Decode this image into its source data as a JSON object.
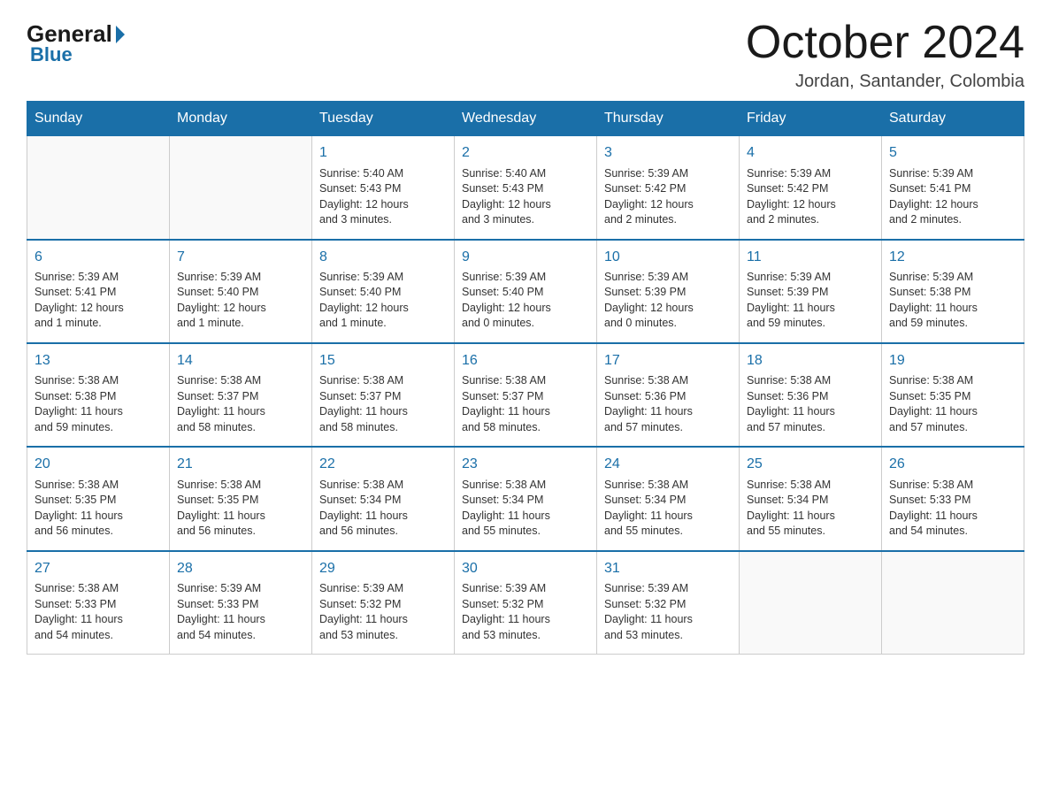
{
  "logo": {
    "general": "General",
    "blue": "Blue"
  },
  "title": "October 2024",
  "location": "Jordan, Santander, Colombia",
  "weekdays": [
    "Sunday",
    "Monday",
    "Tuesday",
    "Wednesday",
    "Thursday",
    "Friday",
    "Saturday"
  ],
  "weeks": [
    [
      {
        "day": "",
        "info": ""
      },
      {
        "day": "",
        "info": ""
      },
      {
        "day": "1",
        "info": "Sunrise: 5:40 AM\nSunset: 5:43 PM\nDaylight: 12 hours\nand 3 minutes."
      },
      {
        "day": "2",
        "info": "Sunrise: 5:40 AM\nSunset: 5:43 PM\nDaylight: 12 hours\nand 3 minutes."
      },
      {
        "day": "3",
        "info": "Sunrise: 5:39 AM\nSunset: 5:42 PM\nDaylight: 12 hours\nand 2 minutes."
      },
      {
        "day": "4",
        "info": "Sunrise: 5:39 AM\nSunset: 5:42 PM\nDaylight: 12 hours\nand 2 minutes."
      },
      {
        "day": "5",
        "info": "Sunrise: 5:39 AM\nSunset: 5:41 PM\nDaylight: 12 hours\nand 2 minutes."
      }
    ],
    [
      {
        "day": "6",
        "info": "Sunrise: 5:39 AM\nSunset: 5:41 PM\nDaylight: 12 hours\nand 1 minute."
      },
      {
        "day": "7",
        "info": "Sunrise: 5:39 AM\nSunset: 5:40 PM\nDaylight: 12 hours\nand 1 minute."
      },
      {
        "day": "8",
        "info": "Sunrise: 5:39 AM\nSunset: 5:40 PM\nDaylight: 12 hours\nand 1 minute."
      },
      {
        "day": "9",
        "info": "Sunrise: 5:39 AM\nSunset: 5:40 PM\nDaylight: 12 hours\nand 0 minutes."
      },
      {
        "day": "10",
        "info": "Sunrise: 5:39 AM\nSunset: 5:39 PM\nDaylight: 12 hours\nand 0 minutes."
      },
      {
        "day": "11",
        "info": "Sunrise: 5:39 AM\nSunset: 5:39 PM\nDaylight: 11 hours\nand 59 minutes."
      },
      {
        "day": "12",
        "info": "Sunrise: 5:39 AM\nSunset: 5:38 PM\nDaylight: 11 hours\nand 59 minutes."
      }
    ],
    [
      {
        "day": "13",
        "info": "Sunrise: 5:38 AM\nSunset: 5:38 PM\nDaylight: 11 hours\nand 59 minutes."
      },
      {
        "day": "14",
        "info": "Sunrise: 5:38 AM\nSunset: 5:37 PM\nDaylight: 11 hours\nand 58 minutes."
      },
      {
        "day": "15",
        "info": "Sunrise: 5:38 AM\nSunset: 5:37 PM\nDaylight: 11 hours\nand 58 minutes."
      },
      {
        "day": "16",
        "info": "Sunrise: 5:38 AM\nSunset: 5:37 PM\nDaylight: 11 hours\nand 58 minutes."
      },
      {
        "day": "17",
        "info": "Sunrise: 5:38 AM\nSunset: 5:36 PM\nDaylight: 11 hours\nand 57 minutes."
      },
      {
        "day": "18",
        "info": "Sunrise: 5:38 AM\nSunset: 5:36 PM\nDaylight: 11 hours\nand 57 minutes."
      },
      {
        "day": "19",
        "info": "Sunrise: 5:38 AM\nSunset: 5:35 PM\nDaylight: 11 hours\nand 57 minutes."
      }
    ],
    [
      {
        "day": "20",
        "info": "Sunrise: 5:38 AM\nSunset: 5:35 PM\nDaylight: 11 hours\nand 56 minutes."
      },
      {
        "day": "21",
        "info": "Sunrise: 5:38 AM\nSunset: 5:35 PM\nDaylight: 11 hours\nand 56 minutes."
      },
      {
        "day": "22",
        "info": "Sunrise: 5:38 AM\nSunset: 5:34 PM\nDaylight: 11 hours\nand 56 minutes."
      },
      {
        "day": "23",
        "info": "Sunrise: 5:38 AM\nSunset: 5:34 PM\nDaylight: 11 hours\nand 55 minutes."
      },
      {
        "day": "24",
        "info": "Sunrise: 5:38 AM\nSunset: 5:34 PM\nDaylight: 11 hours\nand 55 minutes."
      },
      {
        "day": "25",
        "info": "Sunrise: 5:38 AM\nSunset: 5:34 PM\nDaylight: 11 hours\nand 55 minutes."
      },
      {
        "day": "26",
        "info": "Sunrise: 5:38 AM\nSunset: 5:33 PM\nDaylight: 11 hours\nand 54 minutes."
      }
    ],
    [
      {
        "day": "27",
        "info": "Sunrise: 5:38 AM\nSunset: 5:33 PM\nDaylight: 11 hours\nand 54 minutes."
      },
      {
        "day": "28",
        "info": "Sunrise: 5:39 AM\nSunset: 5:33 PM\nDaylight: 11 hours\nand 54 minutes."
      },
      {
        "day": "29",
        "info": "Sunrise: 5:39 AM\nSunset: 5:32 PM\nDaylight: 11 hours\nand 53 minutes."
      },
      {
        "day": "30",
        "info": "Sunrise: 5:39 AM\nSunset: 5:32 PM\nDaylight: 11 hours\nand 53 minutes."
      },
      {
        "day": "31",
        "info": "Sunrise: 5:39 AM\nSunset: 5:32 PM\nDaylight: 11 hours\nand 53 minutes."
      },
      {
        "day": "",
        "info": ""
      },
      {
        "day": "",
        "info": ""
      }
    ]
  ]
}
